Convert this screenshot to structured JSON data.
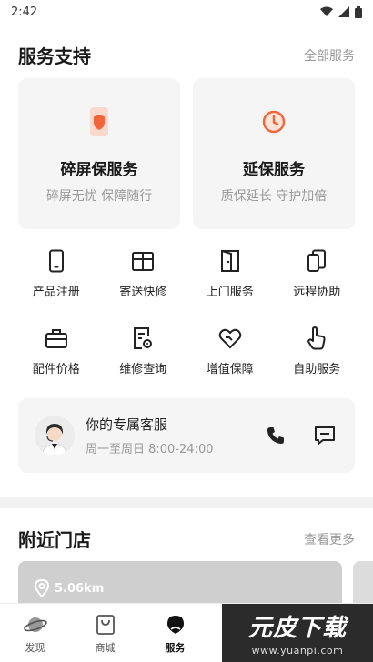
{
  "status_bar": {
    "time": "2:42"
  },
  "services": {
    "title": "服务支持",
    "all_link": "全部服务",
    "cards": [
      {
        "title": "碎屏保服务",
        "subtitle": "碎屏无忧 保障随行",
        "icon": "shield-phone-icon"
      },
      {
        "title": "延保服务",
        "subtitle": "质保延长 守护加倍",
        "icon": "clock-icon"
      }
    ],
    "grid": [
      {
        "label": "产品注册",
        "icon": "phone-register-icon"
      },
      {
        "label": "寄送快修",
        "icon": "package-icon"
      },
      {
        "label": "上门服务",
        "icon": "door-icon"
      },
      {
        "label": "远程协助",
        "icon": "remote-assist-icon"
      },
      {
        "label": "配件价格",
        "icon": "toolbox-icon"
      },
      {
        "label": "维修查询",
        "icon": "repair-query-icon"
      },
      {
        "label": "增值保障",
        "icon": "heart-icon"
      },
      {
        "label": "自助服务",
        "icon": "hand-pointer-icon"
      }
    ]
  },
  "customer_service": {
    "title": "你的专属客服",
    "hours": "周一至周日 8:00-24:00"
  },
  "stores": {
    "title": "附近门店",
    "more_link": "查看更多",
    "distance": "5.06km"
  },
  "tabbar": {
    "tabs": [
      {
        "label": "发现",
        "icon": "planet-icon"
      },
      {
        "label": "商城",
        "icon": "shopping-bag-icon"
      },
      {
        "label": "服务",
        "icon": "service-icon",
        "active": true
      }
    ]
  },
  "watermark": {
    "brand": "元皮下载",
    "url": "www.yuanpi.com"
  },
  "colors": {
    "accent_orange": "#f0653a",
    "muted_text": "#999999",
    "card_bg": "#f5f5f5"
  }
}
